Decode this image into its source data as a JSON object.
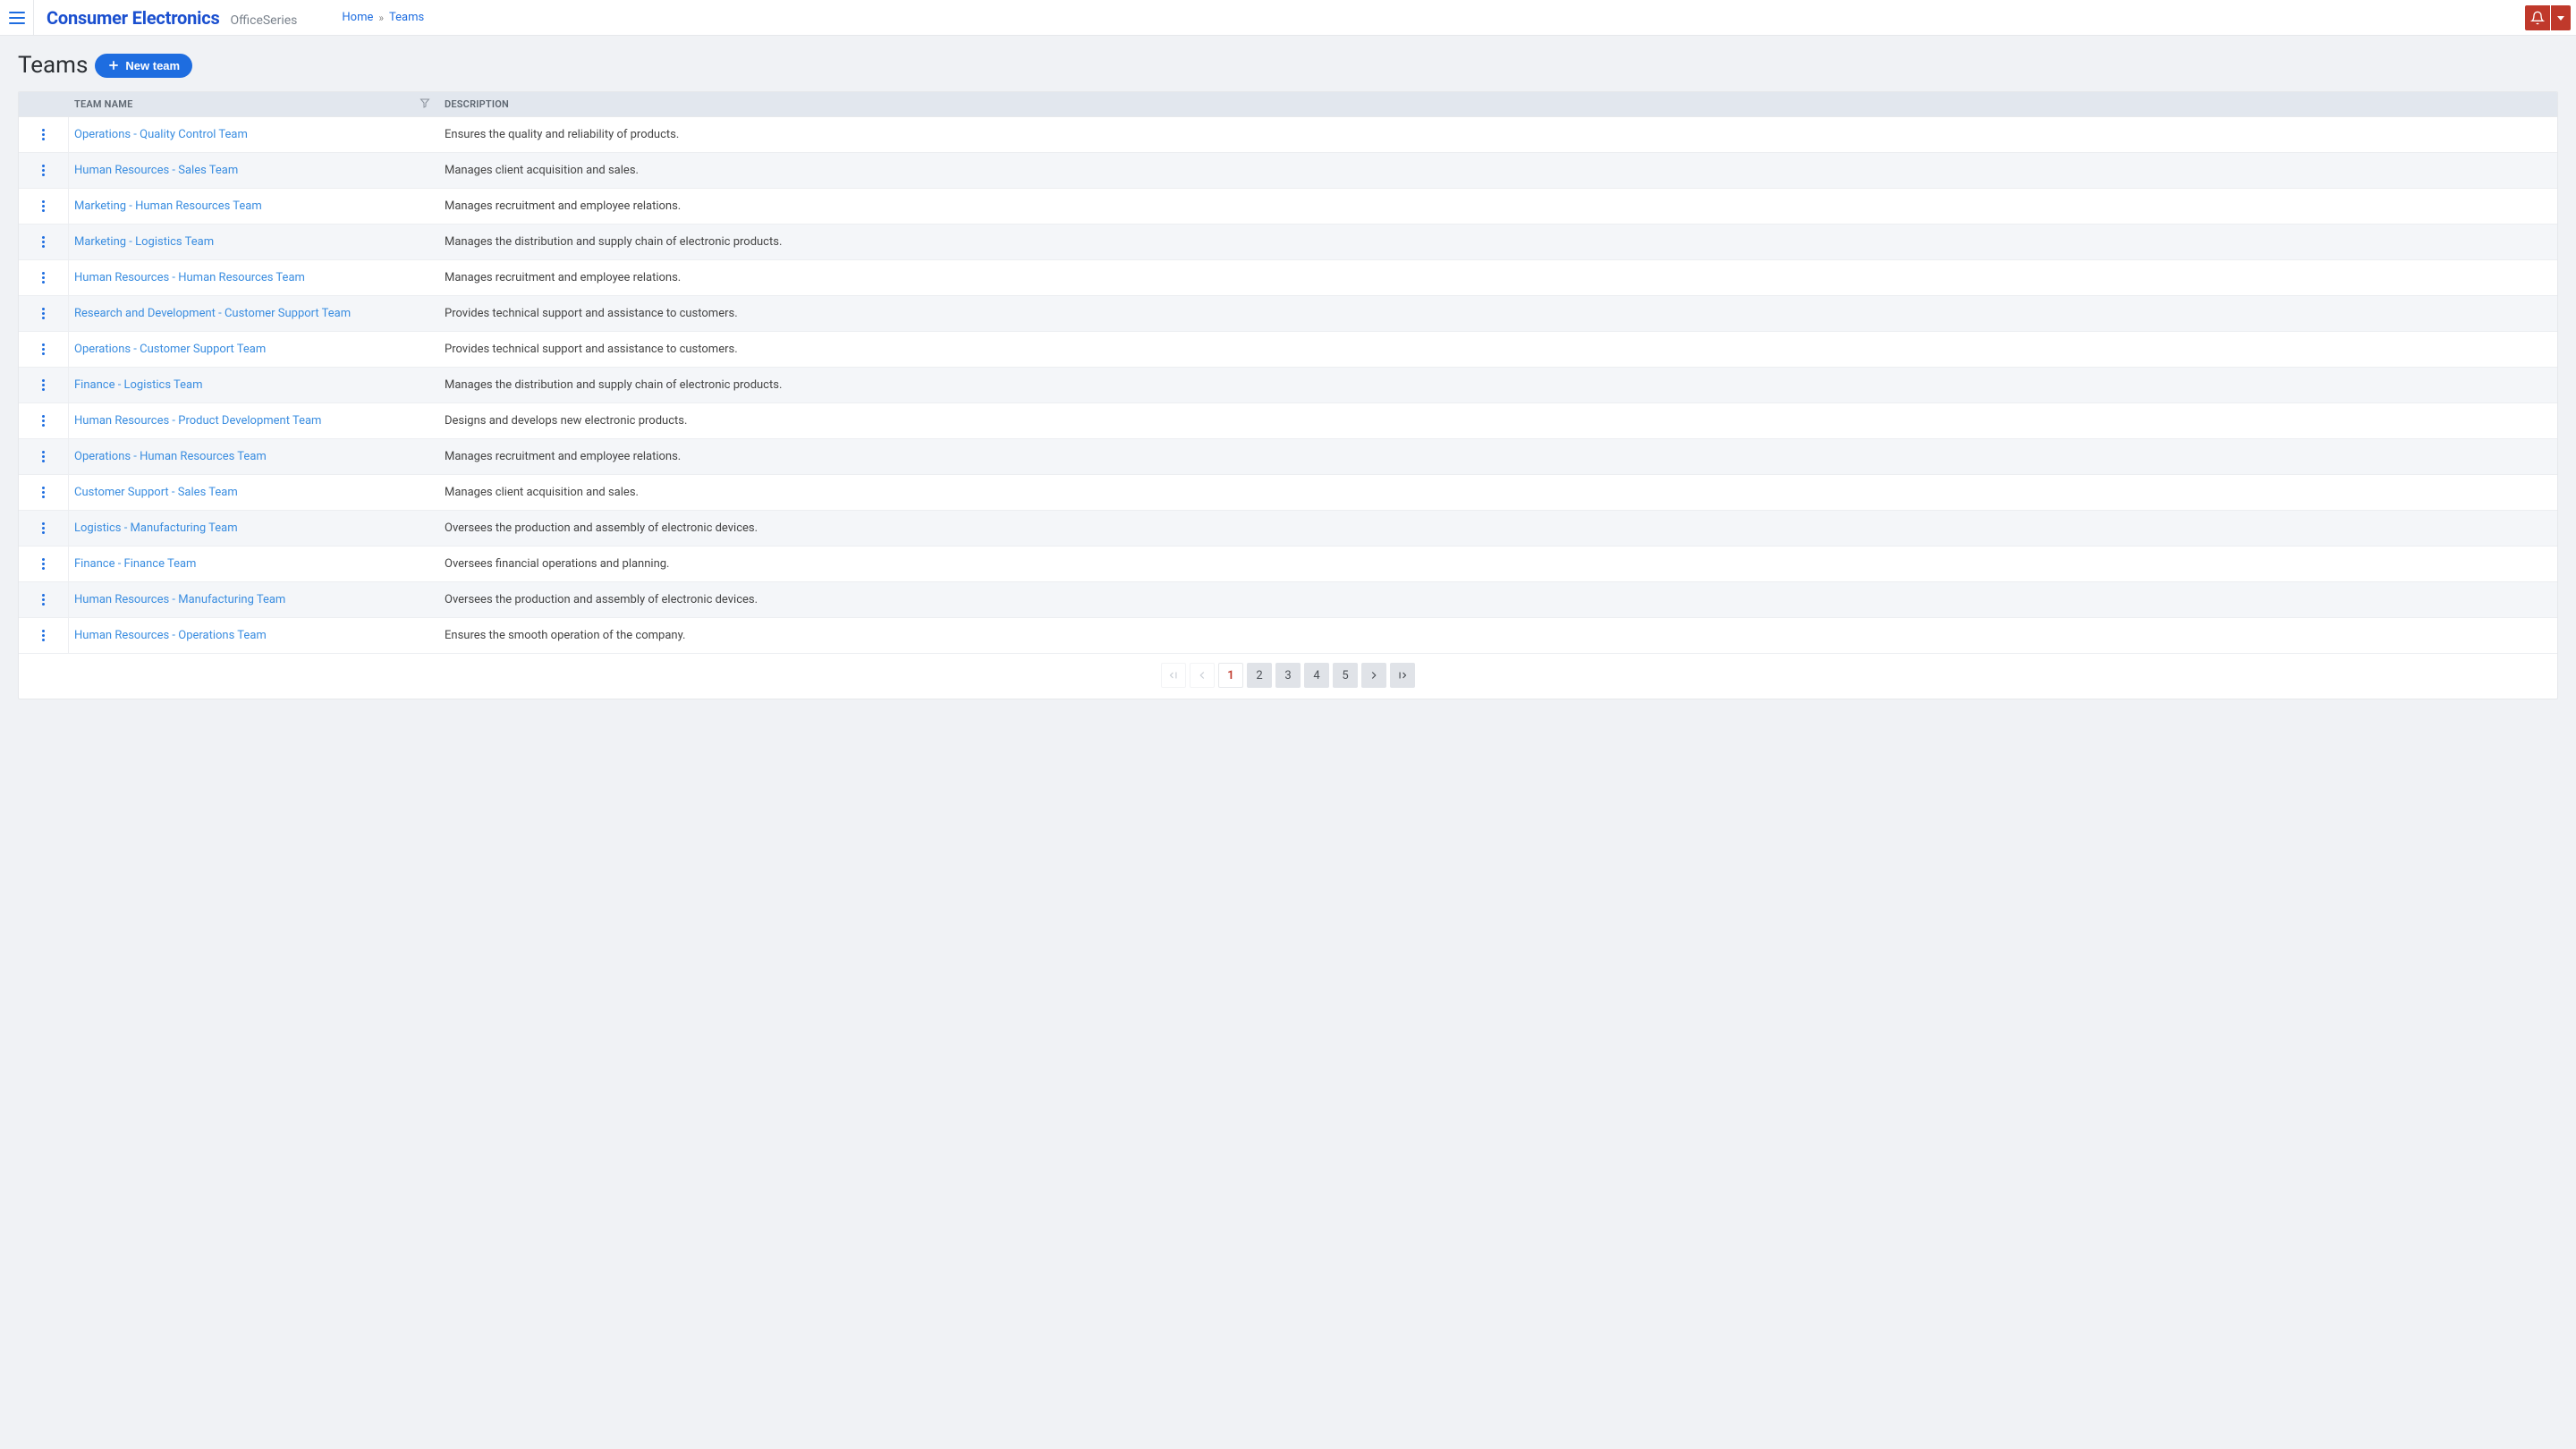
{
  "header": {
    "brand_main": "Consumer Electronics",
    "brand_sub": "OfficeSeries",
    "breadcrumbs": {
      "home": "Home",
      "current": "Teams"
    }
  },
  "page": {
    "title": "Teams",
    "new_team_label": "New team"
  },
  "table": {
    "columns": {
      "name": "Team Name",
      "description": "Description"
    },
    "rows": [
      {
        "name": "Operations - Quality Control Team",
        "description": "Ensures the quality and reliability of products."
      },
      {
        "name": "Human Resources - Sales Team",
        "description": "Manages client acquisition and sales."
      },
      {
        "name": "Marketing - Human Resources Team",
        "description": "Manages recruitment and employee relations."
      },
      {
        "name": "Marketing - Logistics Team",
        "description": "Manages the distribution and supply chain of electronic products."
      },
      {
        "name": "Human Resources - Human Resources Team",
        "description": "Manages recruitment and employee relations."
      },
      {
        "name": "Research and Development - Customer Support Team",
        "description": "Provides technical support and assistance to customers."
      },
      {
        "name": "Operations - Customer Support Team",
        "description": "Provides technical support and assistance to customers."
      },
      {
        "name": "Finance - Logistics Team",
        "description": "Manages the distribution and supply chain of electronic products."
      },
      {
        "name": "Human Resources - Product Development Team",
        "description": "Designs and develops new electronic products."
      },
      {
        "name": "Operations - Human Resources Team",
        "description": "Manages recruitment and employee relations."
      },
      {
        "name": "Customer Support - Sales Team",
        "description": "Manages client acquisition and sales."
      },
      {
        "name": "Logistics - Manufacturing Team",
        "description": "Oversees the production and assembly of electronic devices."
      },
      {
        "name": "Finance - Finance Team",
        "description": "Oversees financial operations and planning."
      },
      {
        "name": "Human Resources - Manufacturing Team",
        "description": "Oversees the production and assembly of electronic devices."
      },
      {
        "name": "Human Resources - Operations Team",
        "description": "Ensures the smooth operation of the company."
      }
    ]
  },
  "pagination": {
    "pages": [
      "1",
      "2",
      "3",
      "4",
      "5"
    ],
    "active": "1"
  }
}
